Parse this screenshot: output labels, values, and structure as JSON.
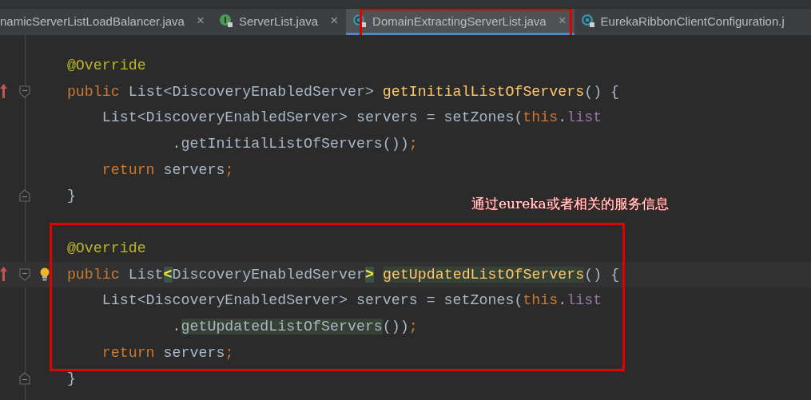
{
  "tabs": [
    {
      "label": "namicServerListLoadBalancer.java",
      "kind": "plain",
      "selected": false,
      "closable": true,
      "boxed": false
    },
    {
      "label": "ServerList.java",
      "kind": "interface",
      "selected": false,
      "closable": true,
      "boxed": false
    },
    {
      "label": "DomainExtractingServerList.java",
      "kind": "class",
      "selected": true,
      "closable": true,
      "boxed": true
    },
    {
      "label": "EurekaRibbonClientConfiguration.j",
      "kind": "class",
      "selected": false,
      "closable": false,
      "boxed": false
    }
  ],
  "close_glyph": "×",
  "note": {
    "text": "通过eureka或者相关的服务信息"
  },
  "blocks": [
    {
      "boxed": false,
      "lines": [
        {
          "override_marker": false,
          "fold_start": false,
          "fold_end": false,
          "current": false,
          "intention": false,
          "tokens": [
            {
              "text": "    @Override",
              "kind": "annotation"
            }
          ]
        },
        {
          "override_marker": true,
          "fold_start": true,
          "fold_end": false,
          "current": false,
          "intention": false,
          "tokens": [
            {
              "text": "    public",
              "kind": "keyword"
            },
            {
              "text": " List<DiscoveryEnabledServer> ",
              "kind": "plain"
            },
            {
              "text": "getInitialListOfServers",
              "kind": "method"
            },
            {
              "text": "() {",
              "kind": "plain"
            }
          ]
        },
        {
          "override_marker": false,
          "fold_start": false,
          "fold_end": false,
          "current": false,
          "intention": false,
          "tokens": [
            {
              "text": "        List<DiscoveryEnabledServer> servers = setZones(",
              "kind": "plain"
            },
            {
              "text": "this",
              "kind": "keyword"
            },
            {
              "text": ".",
              "kind": "plain"
            },
            {
              "text": "list",
              "kind": "field"
            }
          ]
        },
        {
          "override_marker": false,
          "fold_start": false,
          "fold_end": false,
          "current": false,
          "intention": false,
          "tokens": [
            {
              "text": "                .getInitialListOfServers())",
              "kind": "plain"
            },
            {
              "text": ";",
              "kind": "keyword"
            }
          ]
        },
        {
          "override_marker": false,
          "fold_start": false,
          "fold_end": false,
          "current": false,
          "intention": false,
          "tokens": [
            {
              "text": "        return",
              "kind": "keyword"
            },
            {
              "text": " servers",
              "kind": "plain"
            },
            {
              "text": ";",
              "kind": "keyword"
            }
          ]
        },
        {
          "override_marker": false,
          "fold_start": false,
          "fold_end": true,
          "current": false,
          "intention": false,
          "tokens": [
            {
              "text": "    }",
              "kind": "plain"
            }
          ]
        }
      ]
    },
    {
      "boxed": true,
      "lines": [
        {
          "override_marker": false,
          "fold_start": false,
          "fold_end": false,
          "current": false,
          "intention": false,
          "tokens": [
            {
              "text": "    @Override",
              "kind": "annotation"
            }
          ]
        },
        {
          "override_marker": true,
          "fold_start": true,
          "fold_end": false,
          "current": true,
          "intention": true,
          "tokens": [
            {
              "text": "    public",
              "kind": "keyword"
            },
            {
              "text": " List",
              "kind": "plain"
            },
            {
              "text": "<",
              "kind": "brace-match"
            },
            {
              "text": "DiscoveryEnabledServer",
              "kind": "plain"
            },
            {
              "text": ">",
              "kind": "brace-match"
            },
            {
              "text": " getUpdatedListOfServers",
              "kind": "method",
              "highlighted": true
            },
            {
              "text": "() {",
              "kind": "plain"
            }
          ]
        },
        {
          "override_marker": false,
          "fold_start": false,
          "fold_end": false,
          "current": false,
          "intention": false,
          "tokens": [
            {
              "text": "        List<DiscoveryEnabledServer> servers = setZones(",
              "kind": "plain"
            },
            {
              "text": "this",
              "kind": "keyword"
            },
            {
              "text": ".",
              "kind": "plain"
            },
            {
              "text": "list",
              "kind": "field"
            }
          ]
        },
        {
          "override_marker": false,
          "fold_start": false,
          "fold_end": false,
          "current": false,
          "intention": false,
          "tokens": [
            {
              "text": "                .",
              "kind": "plain"
            },
            {
              "text": "getUpdatedListOfServers",
              "kind": "plain",
              "highlighted": true
            },
            {
              "text": "())",
              "kind": "plain"
            },
            {
              "text": ";",
              "kind": "keyword"
            }
          ]
        },
        {
          "override_marker": false,
          "fold_start": false,
          "fold_end": false,
          "current": false,
          "intention": false,
          "tokens": [
            {
              "text": "        return",
              "kind": "keyword"
            },
            {
              "text": " servers",
              "kind": "plain"
            },
            {
              "text": ";",
              "kind": "keyword"
            }
          ]
        },
        {
          "override_marker": false,
          "fold_start": false,
          "fold_end": true,
          "current": false,
          "intention": false,
          "tokens": [
            {
              "text": "    }",
              "kind": "plain"
            }
          ]
        }
      ]
    }
  ]
}
